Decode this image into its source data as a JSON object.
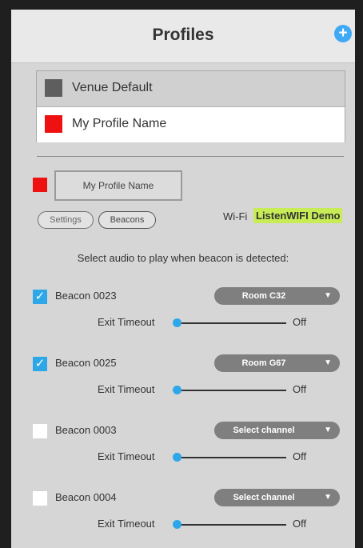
{
  "header": {
    "title": "Profiles",
    "add_icon": "plus-circle-icon",
    "accent": "#3fa9f5"
  },
  "profile_list": [
    {
      "name": "Venue Default",
      "color": "#5e5e5e"
    },
    {
      "name": "My Profile Name",
      "color": "#ee1111"
    }
  ],
  "editor": {
    "profile_name": "My Profile Name",
    "profile_color": "#ee1111",
    "tabs": {
      "settings": "Settings",
      "beacons": "Beacons"
    },
    "wifi_label": "Wi-Fi",
    "wifi_name": "ListenWIFI Demo"
  },
  "instruction": "Select audio to play when beacon is detected:",
  "beacons": [
    {
      "name": "Beacon 0023",
      "checked": true,
      "channel": "Room C32",
      "exit_label": "Exit Timeout",
      "timeout": "Off"
    },
    {
      "name": "Beacon 0025",
      "checked": true,
      "channel": "Room G67",
      "exit_label": "Exit Timeout",
      "timeout": "Off"
    },
    {
      "name": "Beacon 0003",
      "checked": false,
      "channel": "Select channel",
      "exit_label": "Exit Timeout",
      "timeout": "Off"
    },
    {
      "name": "Beacon 0004",
      "checked": false,
      "channel": "Select channel",
      "exit_label": "Exit Timeout",
      "timeout": "Off"
    }
  ]
}
